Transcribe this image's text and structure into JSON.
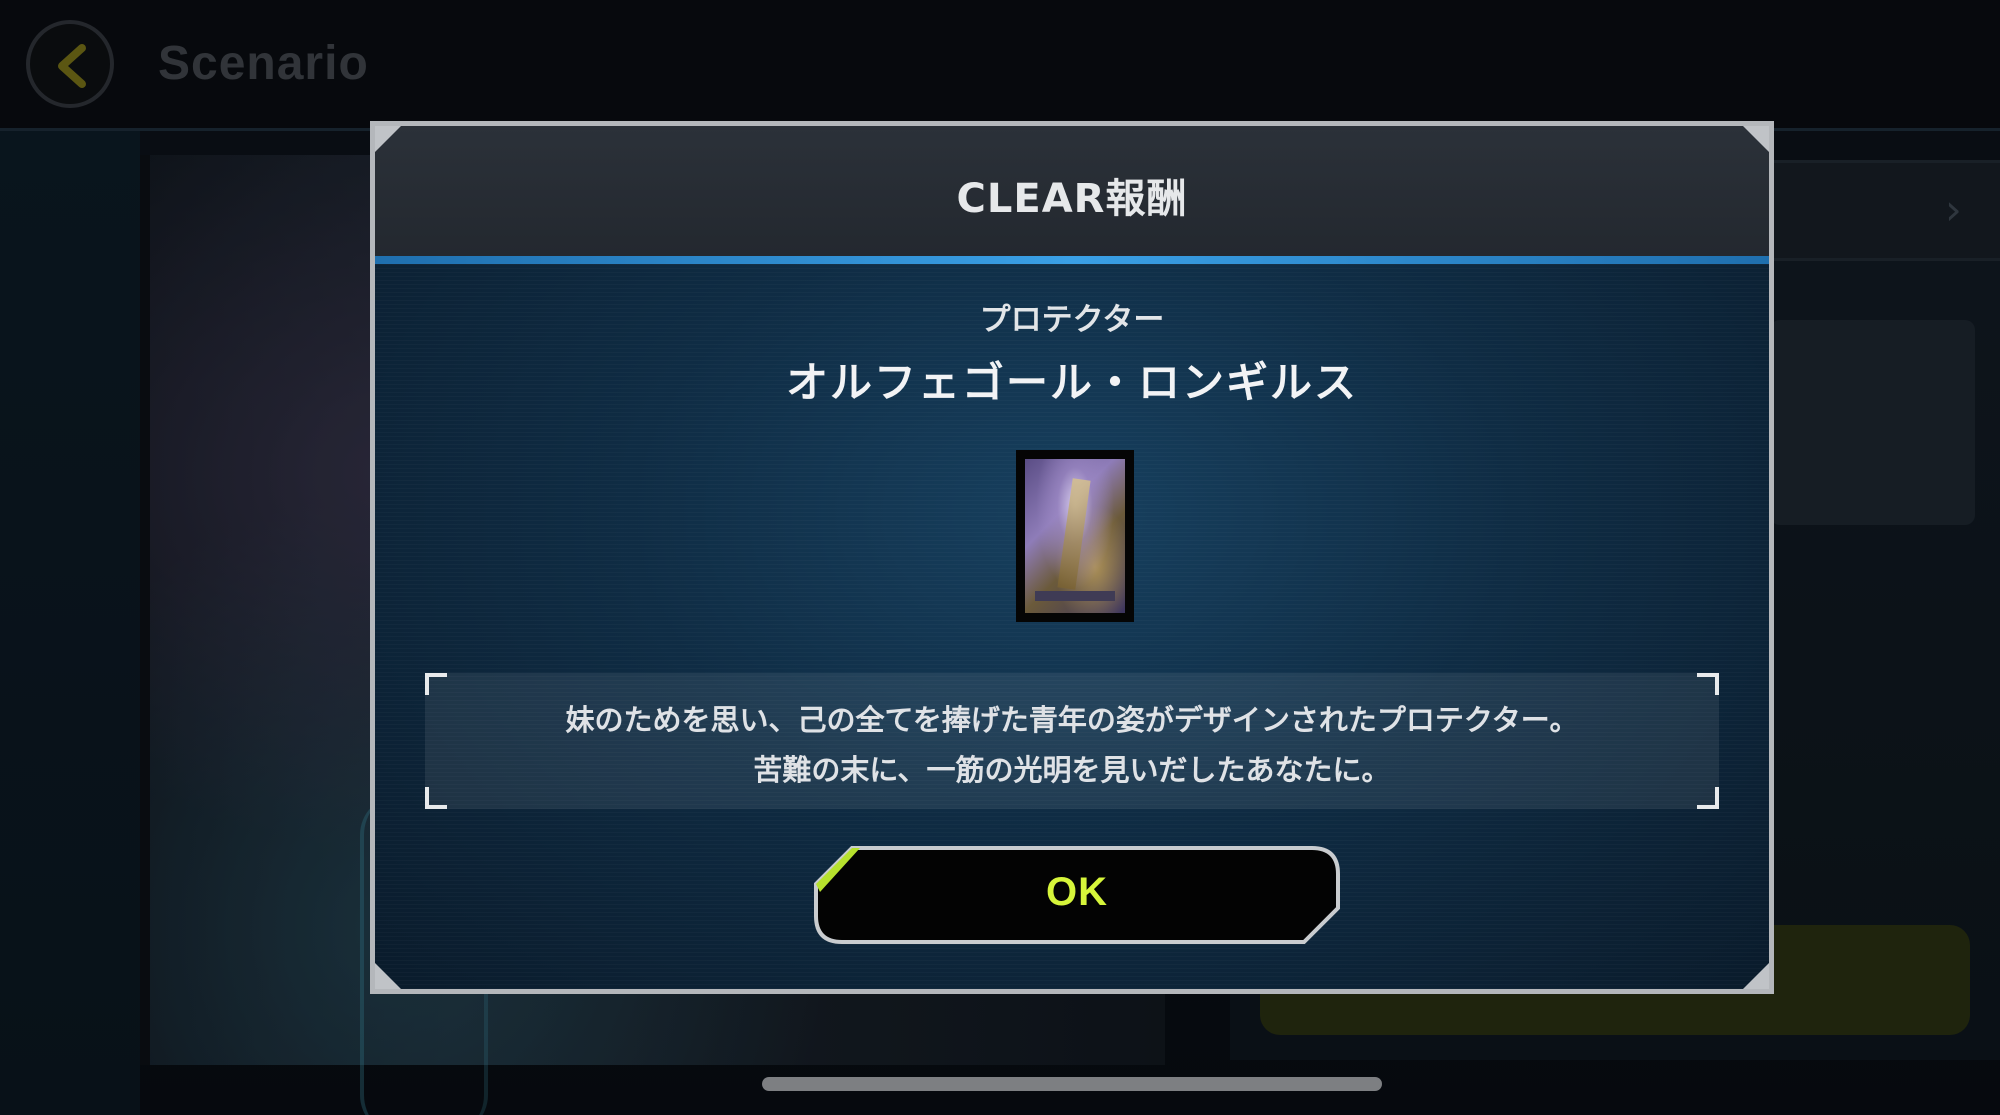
{
  "header": {
    "title": "Scenario",
    "back_icon": "chevron-left-icon"
  },
  "modal": {
    "title": "CLEAR報酬",
    "item_type": "プロテクター",
    "item_name": "オルフェゴール・ロンギルス",
    "description_lines": [
      "妹のためを思い、己の全てを捧げた青年の姿がデザインされたプロテクター。",
      "苦難の末に、一筋の光明を見いだしたあなたに。"
    ],
    "ok_label": "OK"
  },
  "colors": {
    "accent_blue": "#3aa0e6",
    "ok_text": "#d6f53a",
    "modal_bg": "#0f2c44"
  }
}
